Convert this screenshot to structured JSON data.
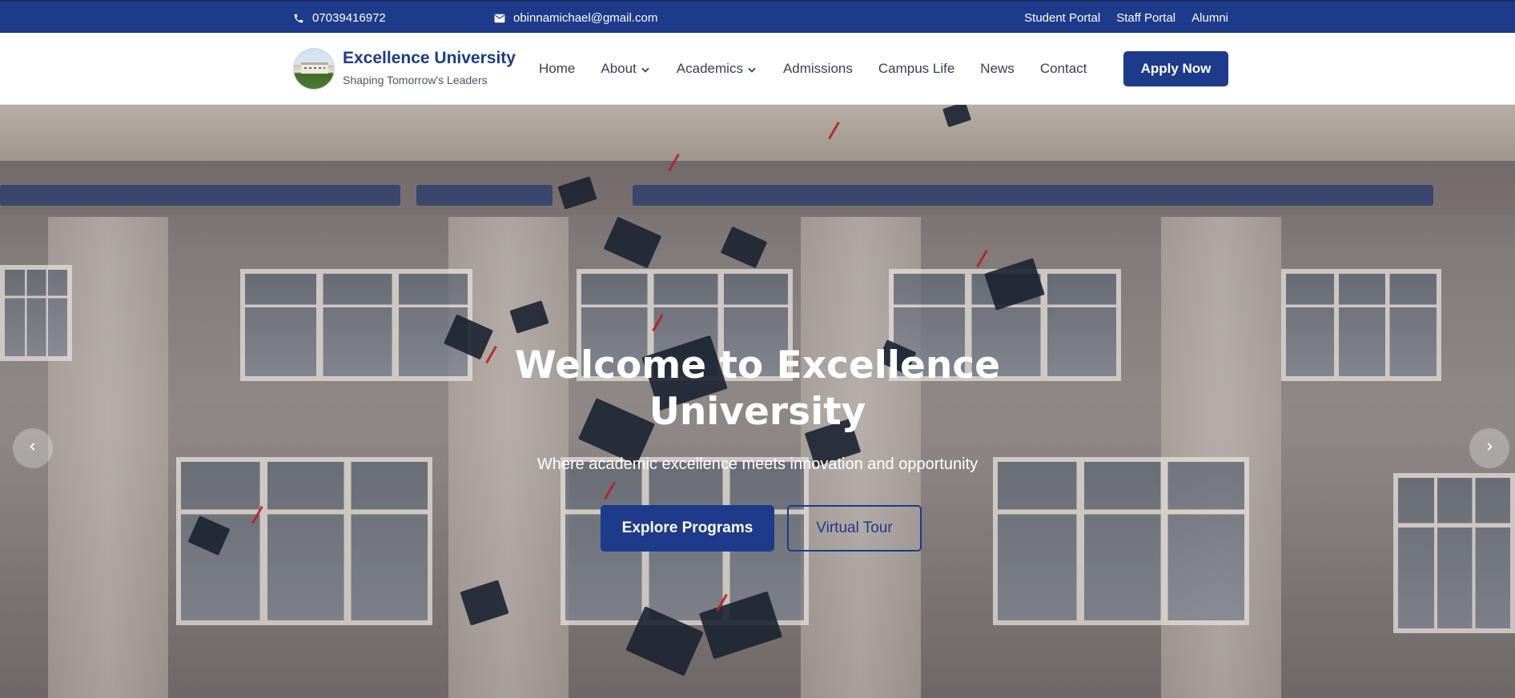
{
  "topbar": {
    "phone": "07039416972",
    "email": "obinnamichael@gmail.com",
    "links": [
      "Student Portal",
      "Staff Portal",
      "Alumni"
    ],
    "phone_icon": "phone-icon",
    "email_icon": "envelope-icon"
  },
  "header": {
    "brand_title": "Excellence University",
    "brand_tagline": "Shaping Tomorrow's Leaders",
    "nav": [
      {
        "label": "Home",
        "dropdown": false
      },
      {
        "label": "About",
        "dropdown": true
      },
      {
        "label": "Academics",
        "dropdown": true
      },
      {
        "label": "Admissions",
        "dropdown": false
      },
      {
        "label": "Campus Life",
        "dropdown": false
      },
      {
        "label": "News",
        "dropdown": false
      },
      {
        "label": "Contact",
        "dropdown": false
      }
    ],
    "apply_label": "Apply Now"
  },
  "hero": {
    "title_line1": "Welcome to Excellence",
    "title_line2": "University",
    "subtitle": "Where academic excellence meets innovation and opportunity",
    "primary_cta": "Explore Programs",
    "secondary_cta": "Virtual Tour",
    "prev_icon": "chevron-left-icon",
    "next_icon": "chevron-right-icon"
  },
  "colors": {
    "brand": "#1e3a8a",
    "white": "#ffffff",
    "text_dark": "#374151"
  }
}
